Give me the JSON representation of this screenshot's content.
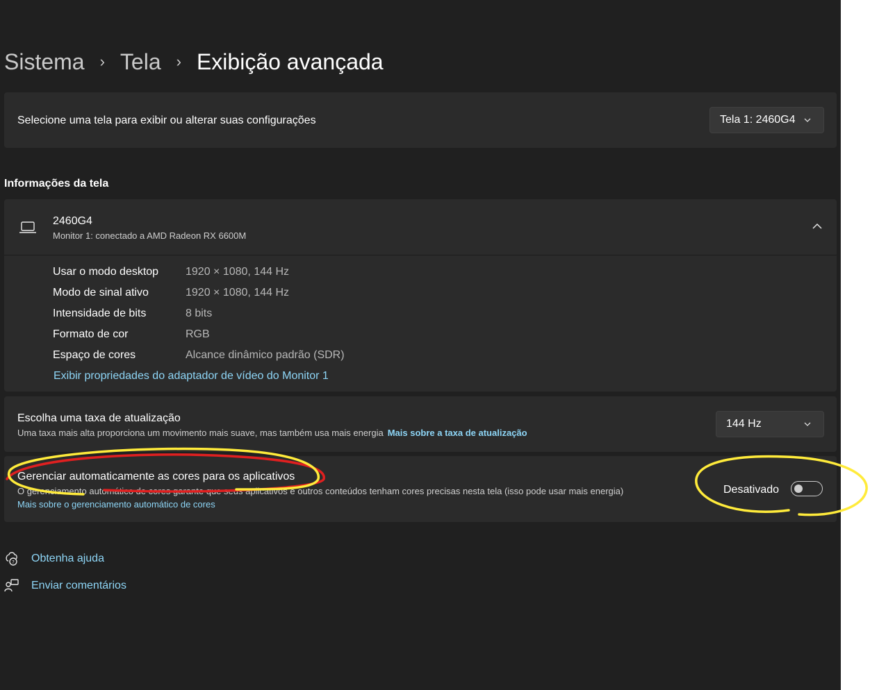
{
  "breadcrumb": {
    "level1": "Sistema",
    "level2": "Tela",
    "current": "Exibição avançada"
  },
  "display_select": {
    "label": "Selecione uma tela para exibir ou alterar suas configurações",
    "selected": "Tela 1: 2460G4"
  },
  "info_section": {
    "title": "Informações da tela",
    "monitor_name": "2460G4",
    "monitor_sub": "Monitor 1: conectado a AMD Radeon RX 6600M",
    "rows": [
      {
        "key": "Usar o modo desktop",
        "value": "1920 × 1080, 144 Hz"
      },
      {
        "key": "Modo de sinal ativo",
        "value": "1920 × 1080, 144 Hz"
      },
      {
        "key": "Intensidade de bits",
        "value": "8 bits"
      },
      {
        "key": "Formato de cor",
        "value": "RGB"
      },
      {
        "key": "Espaço de cores",
        "value": "Alcance dinâmico padrão (SDR)"
      }
    ],
    "adapter_link": "Exibir propriedades do adaptador de vídeo do Monitor 1"
  },
  "refresh_rate": {
    "title": "Escolha uma taxa de atualização",
    "description": "Uma taxa mais alta proporciona um movimento mais suave, mas também usa mais energia",
    "link": "Mais sobre a taxa de atualização",
    "selected": "144 Hz"
  },
  "auto_color": {
    "title": "Gerenciar automaticamente as cores para os aplicativos",
    "description": "O gerenciamento automático de cores garante que seus aplicativos e outros conteúdos tenham cores precisas nesta tela (isso pode usar mais energia)",
    "link": "Mais sobre o gerenciamento automático de cores",
    "toggle_label": "Desativado",
    "toggle_on": false
  },
  "footer": {
    "help": "Obtenha ajuda",
    "feedback": "Enviar comentários"
  },
  "colors": {
    "background": "#202020",
    "card": "#2b2b2b",
    "link": "#8ed6f7",
    "annotation_yellow": "#ffeb3b",
    "annotation_red": "#e02020"
  }
}
